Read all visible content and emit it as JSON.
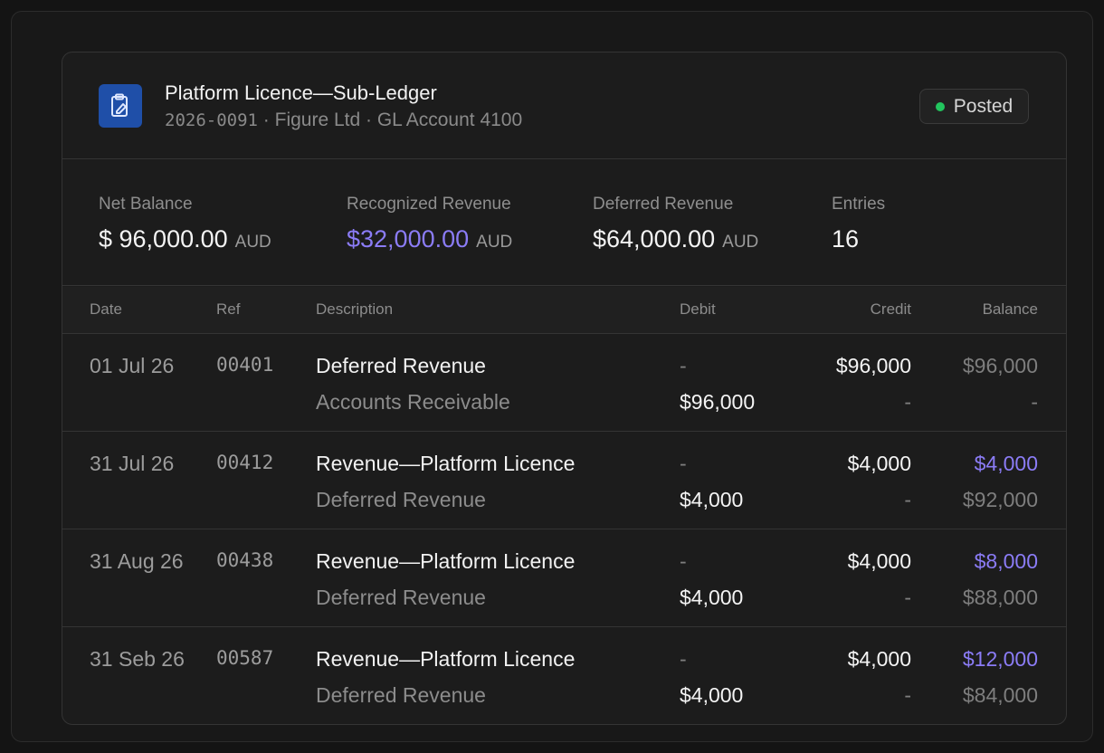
{
  "header": {
    "title": "Platform Licence—Sub-Ledger",
    "code": "2026-0091",
    "subtitle_rest": " · Figure Ltd · GL Account 4100",
    "status": "Posted",
    "status_color": "#22c55e",
    "logo_icon": "clipboard-pen-icon"
  },
  "stats": [
    {
      "label": "Net Balance",
      "value": "$ 96,000.00",
      "currency": "AUD"
    },
    {
      "label": "Recognized Revenue",
      "value": "$32,000.00",
      "currency": "AUD"
    },
    {
      "label": "Deferred Revenue",
      "value": "$64,000.00",
      "currency": "AUD"
    },
    {
      "label": "Entries",
      "value": "16"
    }
  ],
  "table": {
    "columns": [
      "Date",
      "Ref",
      "Description",
      "Debit",
      "Credit",
      "Balance"
    ],
    "rows": [
      {
        "date": "01 Jul 26",
        "ref": "00401",
        "desc1": "Deferred Revenue",
        "desc2": "Accounts Receivable",
        "debit1": "-",
        "debit2": "$96,000",
        "credit1": "$96,000",
        "credit2": "-",
        "bal1": "$96,000",
        "bal2": "-"
      },
      {
        "date": "31 Jul 26",
        "ref": "00412",
        "desc1": "Revenue—Platform Licence",
        "desc2": "Deferred Revenue",
        "debit1": "-",
        "debit2": "$4,000",
        "credit1": "$4,000",
        "credit2": "-",
        "bal1": "$4,000",
        "bal2": "$92,000"
      },
      {
        "date": "31 Aug 26",
        "ref": "00438",
        "desc1": "Revenue—Platform Licence",
        "desc2": "Deferred Revenue",
        "debit1": "-",
        "debit2": "$4,000",
        "credit1": "$4,000",
        "credit2": "-",
        "bal1": "$8,000",
        "bal2": "$88,000"
      },
      {
        "date": "31 Seb 26",
        "ref": "00587",
        "desc1": "Revenue—Platform Licence",
        "desc2": "Deferred Revenue",
        "debit1": "-",
        "debit2": "$4,000",
        "credit1": "$4,000",
        "credit2": "-",
        "bal1": "$12,000",
        "bal2": "$84,000"
      }
    ]
  },
  "colors": {
    "accent": "#8b7cf6",
    "logo_bg": "#1f4fa8"
  }
}
